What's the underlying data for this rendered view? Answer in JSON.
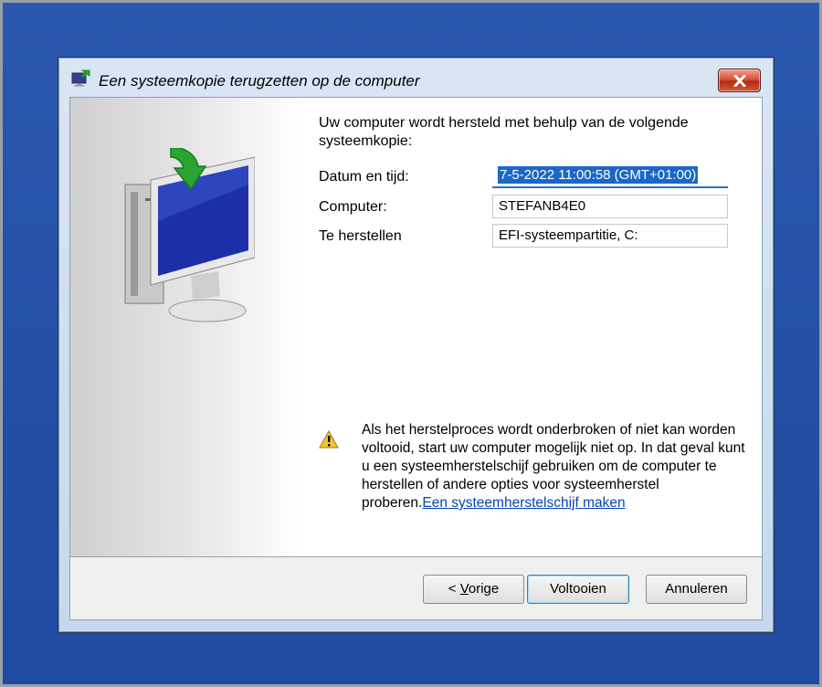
{
  "window": {
    "title": "Een systeemkopie terugzetten op de computer",
    "icons": {
      "app": "system-restore-icon",
      "close": "close-icon"
    }
  },
  "illustration": {
    "icon": "restore-computer-icon",
    "accent": "#2aa52f",
    "screen": "#1d2fa8"
  },
  "intro": "Uw computer wordt hersteld met behulp van de volgende systeemkopie:",
  "fields": [
    {
      "label": "Datum en tijd:",
      "value": "7-5-2022 11:00:58 (GMT+01:00)"
    },
    {
      "label": "Computer:",
      "value": "STEFANB4E0"
    },
    {
      "label": "Te herstellen",
      "value": "EFI-systeempartitie, C:"
    }
  ],
  "warning": {
    "icon": "warning-icon",
    "text": "Als het herstelproces wordt onderbroken of niet kan worden voltooid, start uw computer mogelijk niet op. In dat geval kunt u een systeemherstelschijf gebruiken om de computer te herstellen of andere opties voor systeemherstel proberen.",
    "link": "Een systeemherstelschijf maken"
  },
  "buttons": {
    "back_prefix": "< ",
    "back_access": "V",
    "back_rest": "orige",
    "finish": "Voltooien",
    "cancel": "Annuleren"
  }
}
